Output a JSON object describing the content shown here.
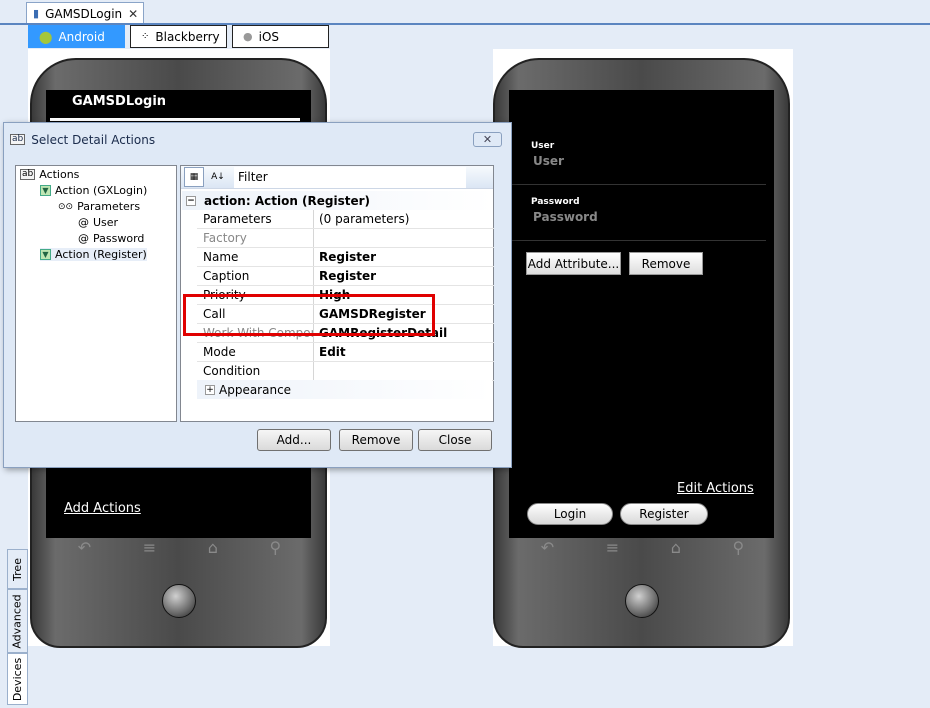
{
  "document_tab": {
    "title": "GAMSDLogin",
    "close": "✕"
  },
  "platforms": [
    {
      "label": "Android",
      "active": true
    },
    {
      "label": "Blackberry",
      "active": false
    },
    {
      "label": "iOS",
      "active": false
    }
  ],
  "side_tabs": [
    "Tree",
    "Advanced",
    "Devices"
  ],
  "left_phone": {
    "title": "GAMSDLogin",
    "link": "Add Actions"
  },
  "right_phone": {
    "user_label": "User",
    "user_value": "User",
    "password_label": "Password",
    "password_value": "Password",
    "add_attribute": "Add Attribute...",
    "remove": "Remove",
    "edit_actions": "Edit Actions",
    "login": "Login",
    "register": "Register"
  },
  "dialog": {
    "title": "Select Detail Actions",
    "close": "✕",
    "tree": {
      "root": "Actions",
      "action1": "Action (GXLogin)",
      "parameters": "Parameters",
      "param_user": "User",
      "param_password": "Password",
      "action2": "Action (Register)"
    },
    "grid": {
      "filter": "Filter",
      "category": "action: Action (Register)",
      "rows": [
        {
          "key": "Parameters",
          "value": "(0 parameters)",
          "bold": false,
          "dim": false
        },
        {
          "key": "Factory",
          "value": "",
          "bold": false,
          "dim": true
        },
        {
          "key": "Name",
          "value": "Register",
          "bold": true,
          "dim": false
        },
        {
          "key": "Caption",
          "value": "Register",
          "bold": true,
          "dim": false
        },
        {
          "key": "Priority",
          "value": "High",
          "bold": true,
          "dim": false
        },
        {
          "key": "Call",
          "value": "GAMSDRegister",
          "bold": true,
          "dim": false
        },
        {
          "key": "Work With Compone",
          "value": "GAMRegisterDetail",
          "bold": true,
          "dim": true
        },
        {
          "key": "Mode",
          "value": "Edit",
          "bold": true,
          "dim": false
        },
        {
          "key": "Condition",
          "value": "",
          "bold": false,
          "dim": false
        }
      ],
      "appearance": "Appearance"
    },
    "buttons": {
      "add": "Add...",
      "remove": "Remove",
      "close": "Close"
    }
  },
  "colors": {
    "accent": "#3399ff",
    "highlight": "#e00000"
  }
}
